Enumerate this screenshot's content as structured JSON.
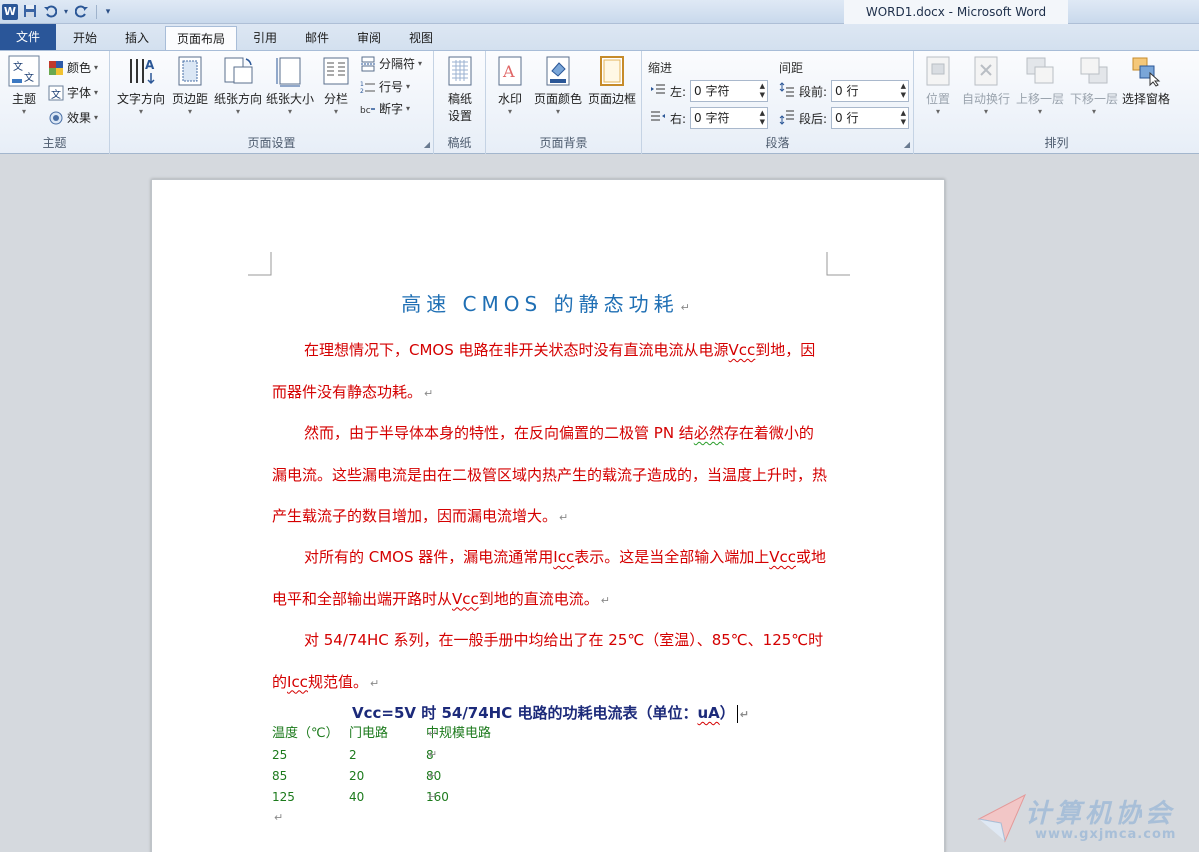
{
  "app": {
    "window_title": "WORD1.docx - Microsoft Word",
    "logo_letter": "W"
  },
  "tabs": [
    {
      "label": "文件"
    },
    {
      "label": "开始"
    },
    {
      "label": "插入"
    },
    {
      "label": "页面布局"
    },
    {
      "label": "引用"
    },
    {
      "label": "邮件"
    },
    {
      "label": "审阅"
    },
    {
      "label": "视图"
    }
  ],
  "ribbon": {
    "theme": {
      "group_label": "主题",
      "themes_button": "主题",
      "colors": "颜色",
      "fonts": "字体",
      "effects": "效果"
    },
    "page_setup": {
      "group_label": "页面设置",
      "text_direction": "文字方向",
      "margins": "页边距",
      "orientation": "纸张方向",
      "size": "纸张大小",
      "columns": "分栏",
      "breaks": "分隔符",
      "line_numbers": "行号",
      "hyphenation": "断字"
    },
    "manuscript": {
      "group_label": "稿纸",
      "button_line1": "稿纸",
      "button_line2": "设置"
    },
    "page_background": {
      "group_label": "页面背景",
      "watermark": "水印",
      "page_color": "页面颜色",
      "page_borders": "页面边框"
    },
    "paragraph": {
      "group_label": "段落",
      "indent_label": "缩进",
      "spacing_label": "间距",
      "left_label": "左:",
      "left_value": "0 字符",
      "right_label": "右:",
      "right_value": "0 字符",
      "before_label": "段前:",
      "before_value": "0 行",
      "after_label": "段后:",
      "after_value": "0 行"
    },
    "arrange": {
      "group_label": "排列",
      "position": "位置",
      "wrap_text": "自动换行",
      "bring_forward": "上移一层",
      "send_backward": "下移一层",
      "selection_pane": "选择窗格"
    }
  },
  "document": {
    "title": "高速 CMOS 的静态功耗",
    "p1_a": "在理想情况下，CMOS 电路在非开关状态时没有直流电流从电源",
    "p1_vcc": "Vcc",
    "p1_b": "到地，因而器件没有静态功耗。",
    "p2_a": "然而，由于半导体本身的特性，在反向偏置的二极管 PN 结",
    "p2_bi": "必然",
    "p2_b": "存在着微小的漏电流。这些漏电流是由在二极管区域内热产生的载流子造成的，当温度上升时，热产生载流子的数目增加，因而漏电流增大。",
    "p3_a": "对所有的 CMOS 器件，漏电流通常用",
    "p3_icc": "Icc",
    "p3_b": "表示。这是当全部输入端加上",
    "p3_vcc": "Vcc",
    "p3_c": "或地电平和全部输出端开路时从",
    "p3_vcc2": "Vcc",
    "p3_d": "到地的直流电流。",
    "p4_a": "对 54/74HC 系列，在一般手册中均给出了在 25℃（室温）、85℃、125℃时的",
    "p4_icc": "Icc",
    "p4_b": "规范值。",
    "table_title_a": "Vcc=5V 时 54/74HC 电路的功耗电流表（单位：",
    "table_title_ua": "uA",
    "table_title_b": "）",
    "table_headers": [
      "温度（℃）",
      "门电路",
      "中规模电路"
    ],
    "table_rows": [
      [
        "25",
        "2",
        "8"
      ],
      [
        "85",
        "20",
        "80"
      ],
      [
        "125",
        "40",
        "160"
      ]
    ],
    "pilcrow": "↵"
  },
  "watermark": {
    "text": "计算机协会",
    "url": "www.gxjmca.com"
  },
  "colors": {
    "body_text": "#d40000",
    "title": "#1f6fb4",
    "table_text": "#1c7a1c",
    "file_tab": "#2a5699"
  }
}
